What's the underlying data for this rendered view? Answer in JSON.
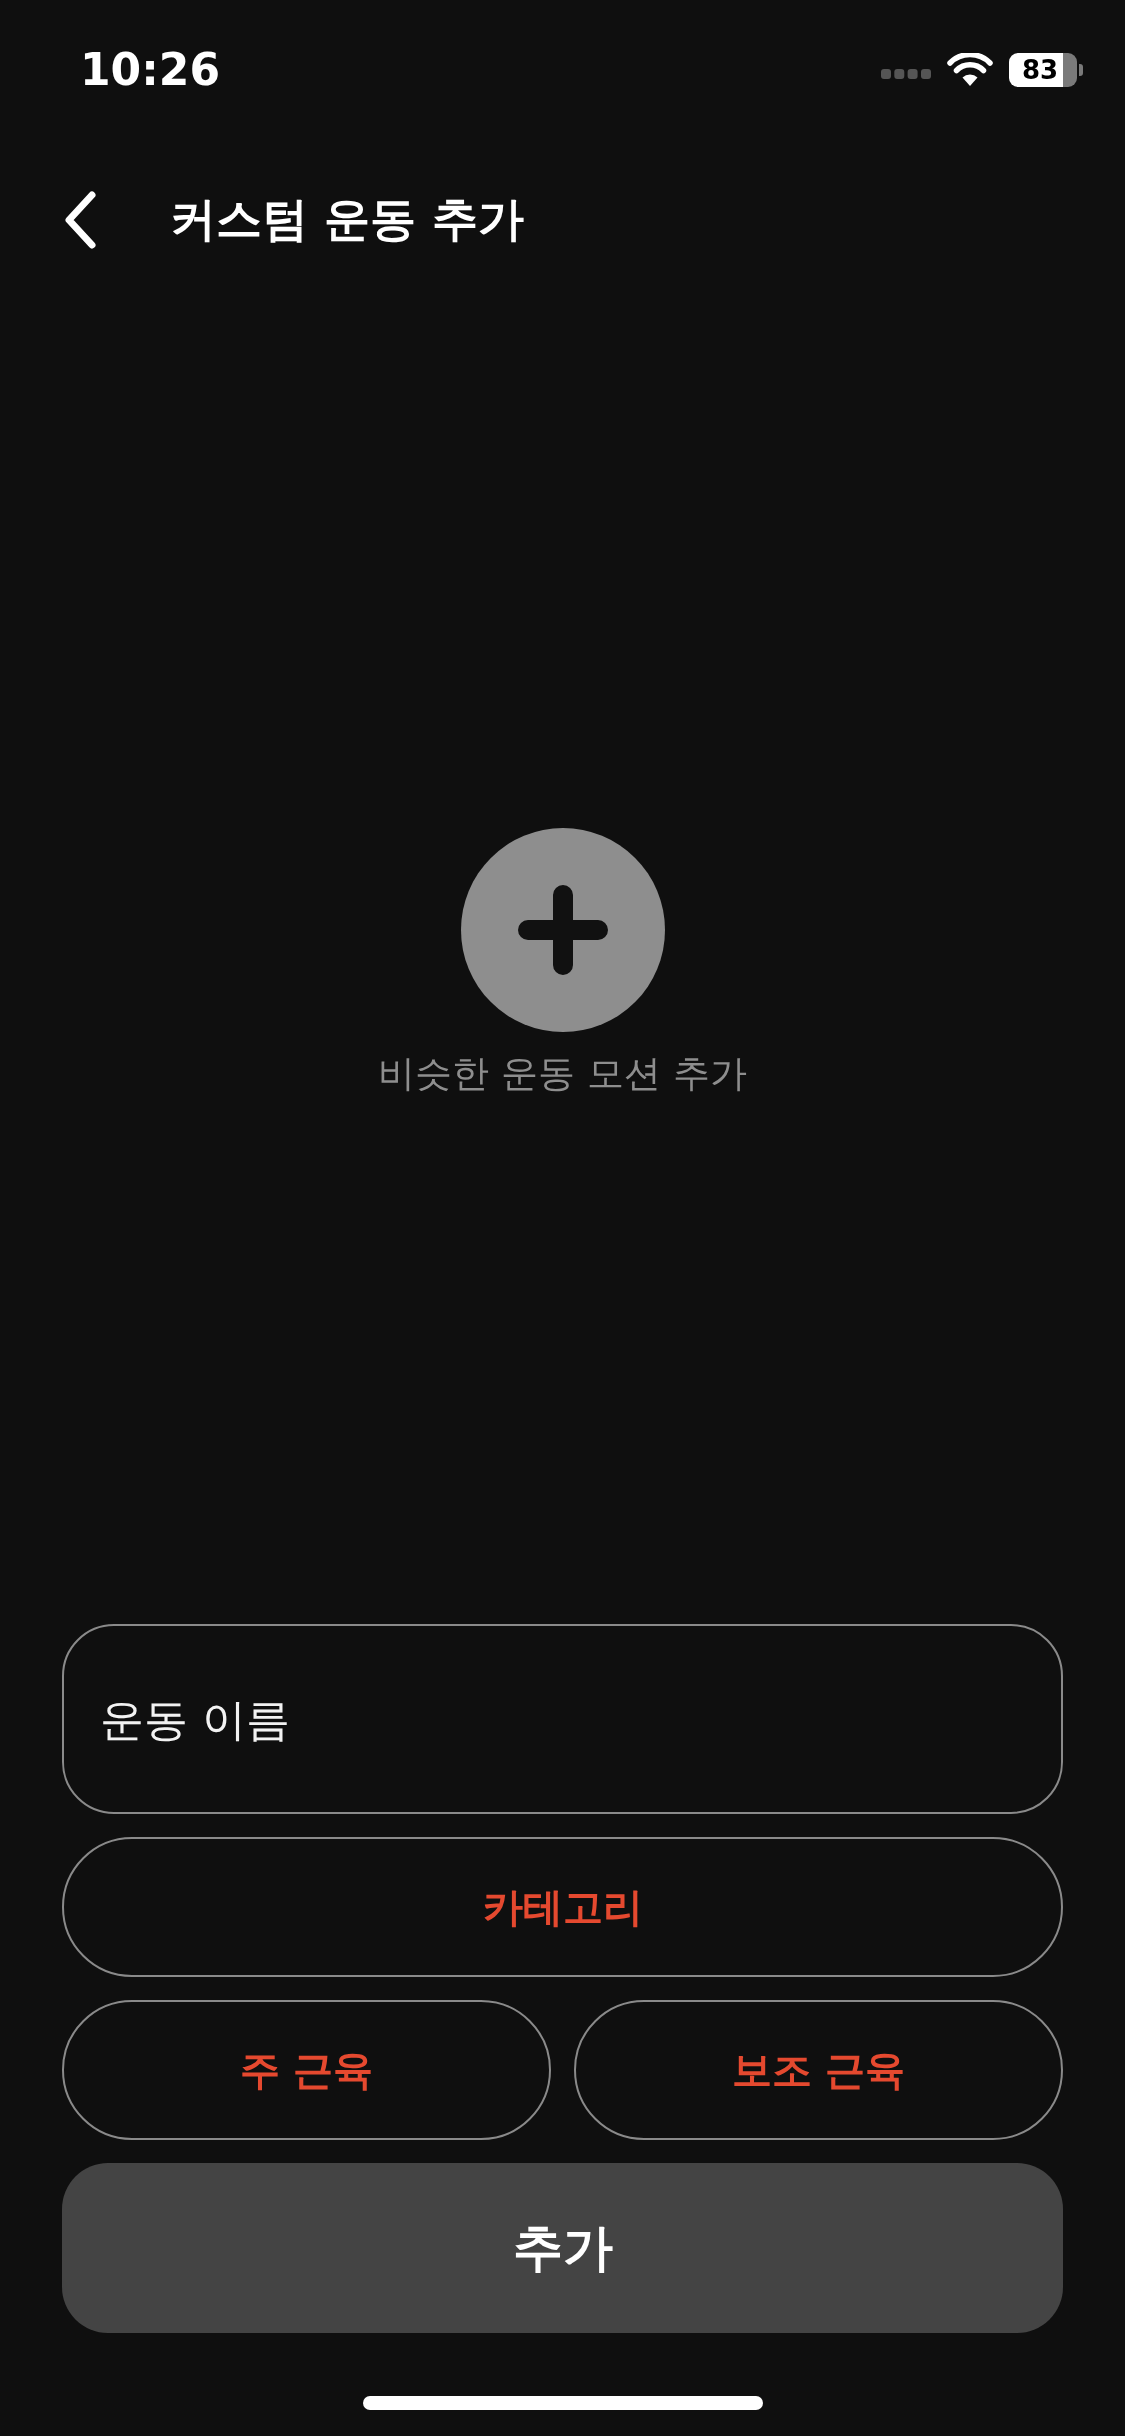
{
  "status_bar": {
    "time": "10:26",
    "battery": "83"
  },
  "header": {
    "title": "커스텀 운동 추가"
  },
  "add_motion": {
    "label": "비슷한 운동 모션 추가"
  },
  "form": {
    "name_field": {
      "placeholder": "운동 이름"
    },
    "category": {
      "label": "카테고리"
    },
    "muscles": [
      {
        "label": "주 근육"
      },
      {
        "label": "보조 근육"
      }
    ],
    "submit": {
      "label": "추가"
    }
  }
}
